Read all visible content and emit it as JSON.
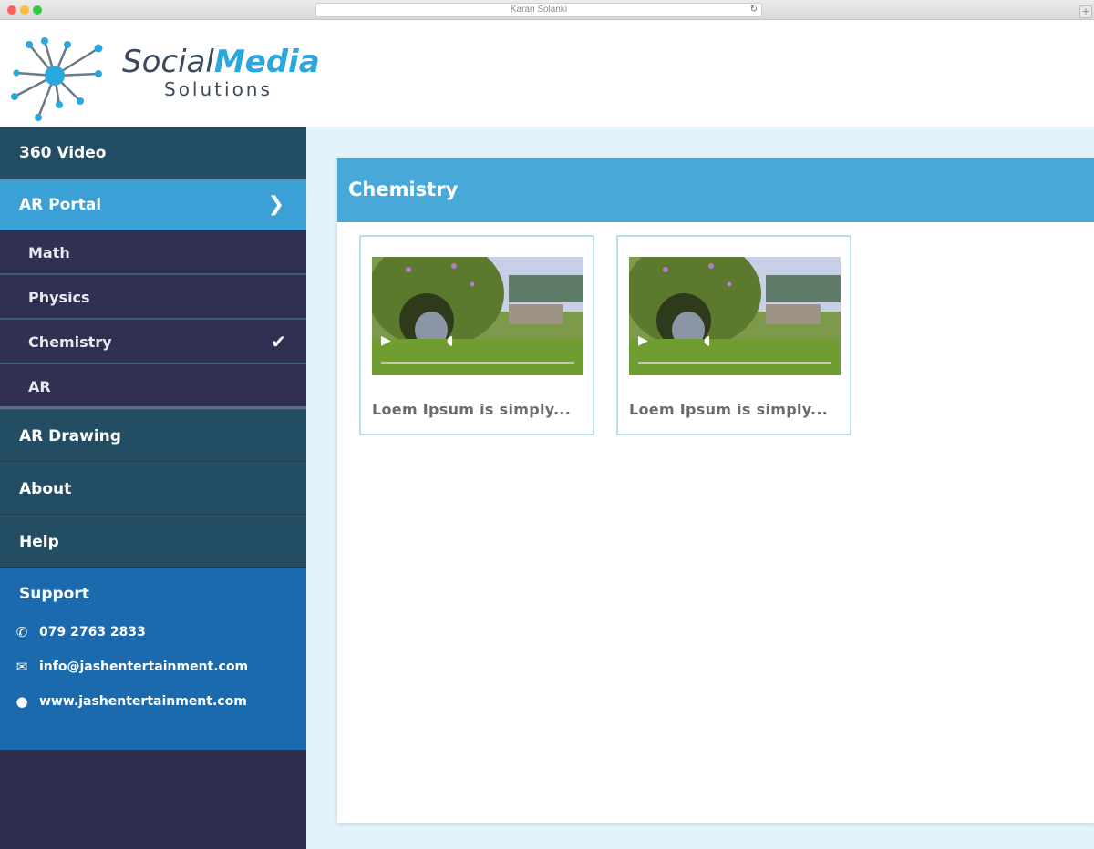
{
  "browser": {
    "url_text": "Karan Solanki"
  },
  "brand": {
    "word_social": "Social",
    "word_media": "Media",
    "sub": "Solutions"
  },
  "sidebar": {
    "items": [
      {
        "label": "360 Video"
      },
      {
        "label": "AR Portal"
      },
      {
        "label": "Math"
      },
      {
        "label": "Physics"
      },
      {
        "label": "Chemistry"
      },
      {
        "label": "AR"
      },
      {
        "label": "AR Drawing"
      },
      {
        "label": "About"
      },
      {
        "label": "Help"
      }
    ],
    "support": {
      "title": "Support",
      "phone": "079 2763 2833",
      "email": "info@jashentertainment.com",
      "website": "www.jashentertainment.com"
    }
  },
  "main": {
    "panel_title": "Chemistry",
    "cards": [
      {
        "caption": "Loem Ipsum is simply..."
      },
      {
        "caption": "Loem Ipsum is simply..."
      }
    ]
  },
  "colors": {
    "accent": "#3aa0d5",
    "sidebar_bg": "#2e2d4e",
    "nav_dark": "#224d63",
    "support_bg": "#1a6aad"
  },
  "icons": [
    "chevron-right-icon",
    "check-icon",
    "phone-icon",
    "envelope-icon",
    "globe-icon",
    "play-icon",
    "volume-icon"
  ]
}
